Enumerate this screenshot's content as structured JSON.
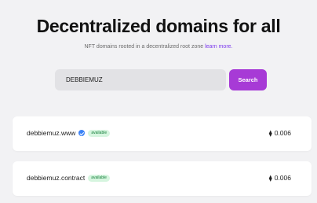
{
  "hero": {
    "title": "Decentralized domains for all",
    "subtitle": "NFT domains rooted in a decentralized root zone",
    "subtitle_link": "learn more.",
    "link_color": "#7c3aed"
  },
  "search": {
    "value": "DEBBIEMUZ",
    "button_label": "Search",
    "button_color": "#a73ad6"
  },
  "results": [
    {
      "domain": "debbiemuz.www",
      "verified": true,
      "status": "available",
      "price": "0.006",
      "currency_icon": "ethereum-icon"
    },
    {
      "domain": "debbiemuz.contract",
      "verified": false,
      "status": "available",
      "price": "0.006",
      "currency_icon": "ethereum-icon"
    }
  ]
}
